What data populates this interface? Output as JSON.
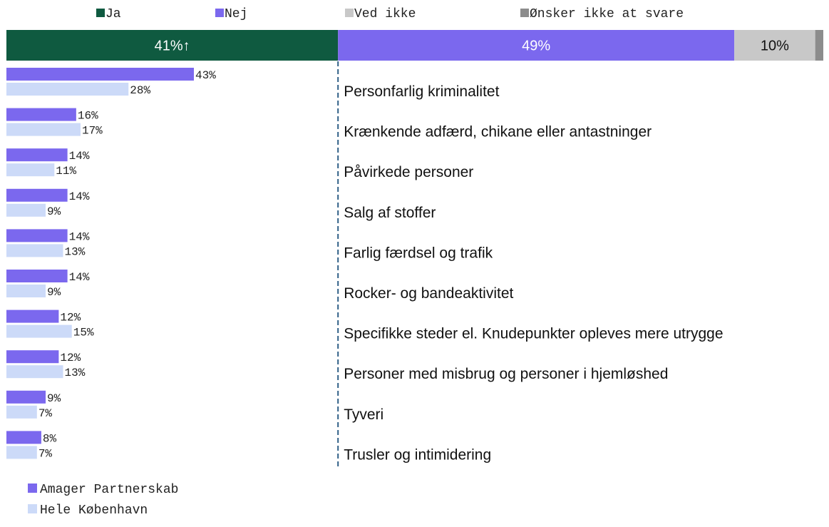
{
  "colors": {
    "ja": "#0f5a40",
    "nej": "#7b68ee",
    "ved_ikke": "#c8c8c8",
    "onsker_ikke": "#8c8c8c",
    "amager": "#7b68ee",
    "hele_kbh": "#ccdaf8",
    "divider": "#2f5f87",
    "text": "#222222"
  },
  "chart_data": [
    {
      "type": "bar",
      "orientation": "horizontal-stacked",
      "legend_position": "top",
      "legend": [
        {
          "key": "ja",
          "label": "Ja"
        },
        {
          "key": "nej",
          "label": "Nej"
        },
        {
          "key": "ved_ikke",
          "label": "Ved ikke"
        },
        {
          "key": "onsker_ikke",
          "label": "Ønsker ikke at svare"
        }
      ],
      "segments": [
        {
          "key": "ja",
          "value": 41,
          "label": "41%↑"
        },
        {
          "key": "nej",
          "value": 49,
          "label": "49%"
        },
        {
          "key": "ved_ikke",
          "value": 10,
          "label": "10%"
        },
        {
          "key": "onsker_ikke",
          "value": 1,
          "label": ""
        }
      ]
    },
    {
      "type": "bar",
      "orientation": "horizontal",
      "legend_position": "bottom-left",
      "xlim": [
        0,
        43
      ],
      "categories": [
        "Personfarlig kriminalitet",
        "Krænkende adfærd, chikane eller antastninger",
        "Påvirkede personer",
        "Salg af stoffer",
        "Farlig færdsel og trafik",
        "Rocker- og bandeaktivitet",
        "Specifikke steder el. Knudepunkter opleves mere utrygge",
        "Personer med misbrug og personer i hjemløshed",
        "Tyveri",
        "Trusler og intimidering"
      ],
      "series": [
        {
          "name": "Amager Partnerskab",
          "key": "amager",
          "values": [
            43,
            16,
            14,
            14,
            14,
            14,
            12,
            12,
            9,
            8
          ]
        },
        {
          "name": "Hele København",
          "key": "hele_kbh",
          "values": [
            28,
            17,
            11,
            9,
            13,
            9,
            15,
            13,
            7,
            7
          ]
        }
      ]
    }
  ]
}
